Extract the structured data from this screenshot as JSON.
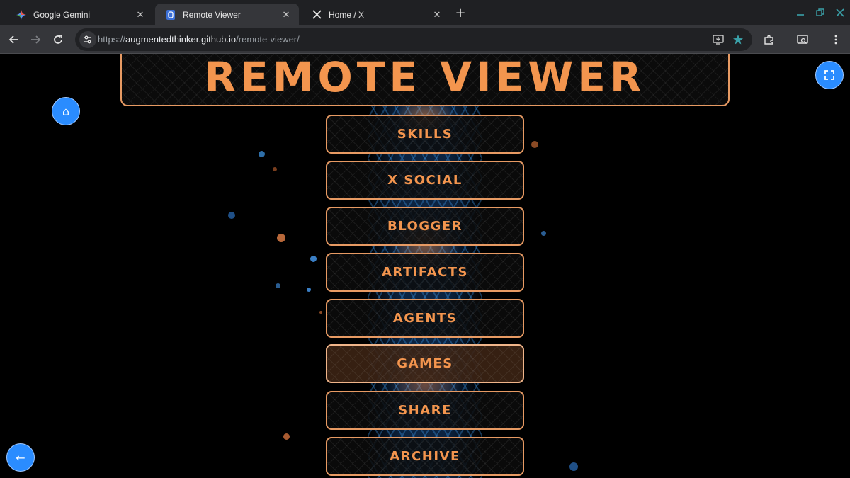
{
  "browser": {
    "tabs": [
      {
        "title": "Google Gemini",
        "icon": "gemini-icon"
      },
      {
        "title": "Remote Viewer",
        "icon": "remote-viewer-favicon",
        "active": true
      },
      {
        "title": "Home / X",
        "icon": "x-logo-icon"
      }
    ],
    "close_glyph": "✕",
    "new_tab_glyph": "+",
    "url_prefix": "https://",
    "url_host": "augmentedthinker.github.io",
    "url_path": "/remote-viewer/"
  },
  "page": {
    "title": "REMOTE VIEWER",
    "menu": [
      {
        "label": "SKILLS"
      },
      {
        "label": "X SOCIAL"
      },
      {
        "label": "BLOGGER"
      },
      {
        "label": "ARTIFACTS"
      },
      {
        "label": "AGENTS"
      },
      {
        "label": "GAMES",
        "hover": true
      },
      {
        "label": "SHARE"
      },
      {
        "label": "ARCHIVE"
      }
    ],
    "home_glyph": "⌂",
    "back_glyph": "←",
    "fullscreen_glyph": "⛶"
  },
  "colors": {
    "accent_orange": "#f3954e",
    "button_blue": "#2a8cff",
    "chrome_dark": "#1f2023"
  }
}
